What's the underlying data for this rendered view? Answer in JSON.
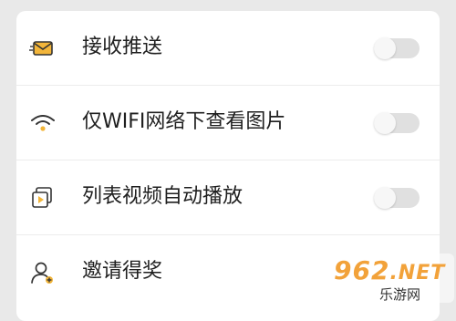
{
  "settings": {
    "items": [
      {
        "label": "接收推送",
        "icon": "envelope-icon",
        "toggle_on": false
      },
      {
        "label": "仅WIFI网络下查看图片",
        "icon": "wifi-icon",
        "toggle_on": false
      },
      {
        "label": "列表视频自动播放",
        "icon": "video-play-icon",
        "toggle_on": false
      },
      {
        "label": "邀请得奖",
        "icon": "add-user-icon"
      }
    ]
  },
  "watermark": {
    "brand": "962",
    "domain": ".NET",
    "name": "乐游网"
  },
  "colors": {
    "accent": "#f2b53a",
    "icon_stroke": "#333333",
    "toggle_off": "#e0e0e0",
    "background": "#e9e9e9"
  }
}
